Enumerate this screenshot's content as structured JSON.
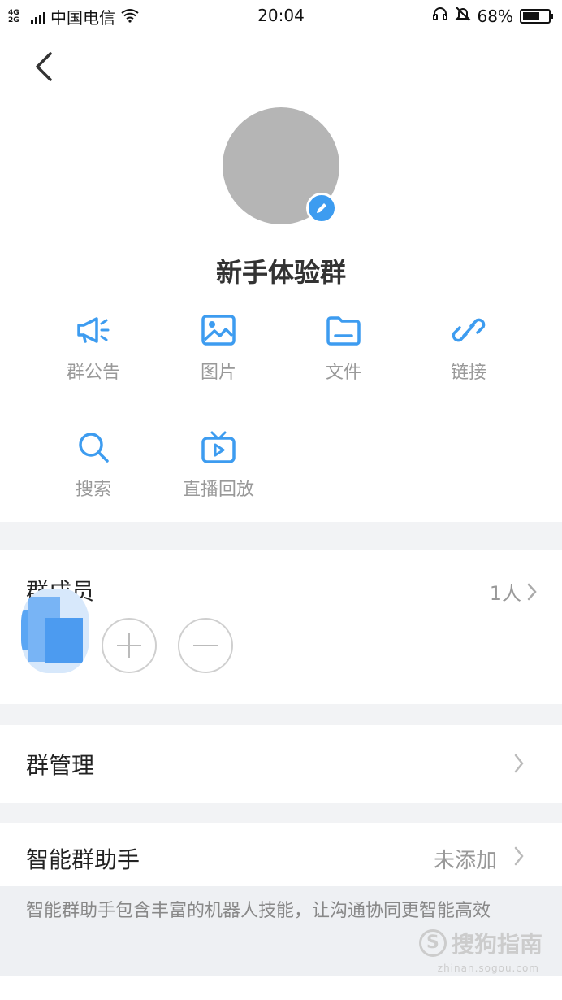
{
  "status_bar": {
    "network": "4G\n2G",
    "carrier": "中国电信",
    "time": "20:04",
    "battery": "68%"
  },
  "group": {
    "name": "新手体验群"
  },
  "functions": [
    {
      "label": "群公告",
      "icon": "megaphone-icon"
    },
    {
      "label": "图片",
      "icon": "image-icon"
    },
    {
      "label": "文件",
      "icon": "folder-icon"
    },
    {
      "label": "链接",
      "icon": "link-icon"
    },
    {
      "label": "搜索",
      "icon": "search-icon"
    },
    {
      "label": "直播回放",
      "icon": "tv-replay-icon"
    }
  ],
  "members": {
    "title": "群成员",
    "count": "1人"
  },
  "rows": {
    "manage": {
      "label": "群管理"
    },
    "assistant": {
      "label": "智能群助手",
      "value": "未添加"
    }
  },
  "assistant_desc": "智能群助手包含丰富的机器人技能，让沟通协同更智能高效",
  "watermark": {
    "text": "搜狗指南",
    "sub": "zhinan.sogou.com"
  },
  "colors": {
    "accent": "#3d9cf0",
    "avatar": "#b5b5b5"
  }
}
